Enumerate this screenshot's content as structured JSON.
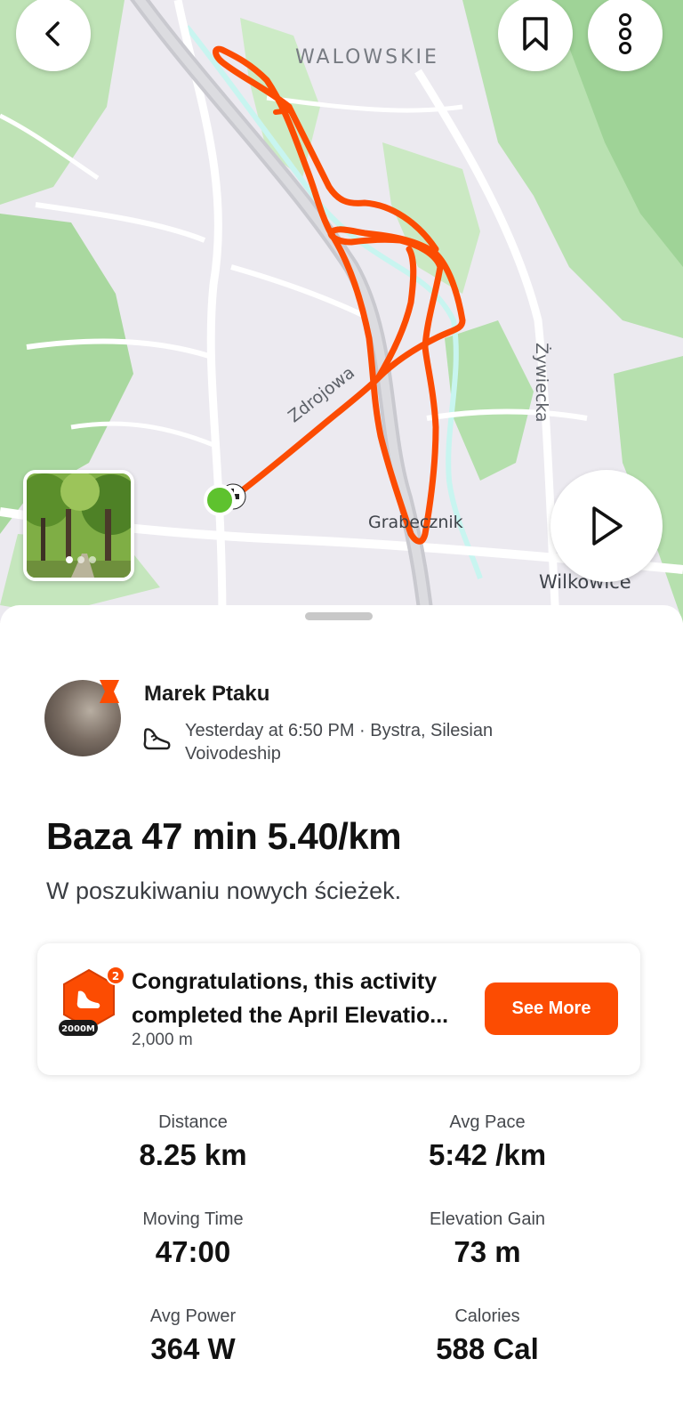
{
  "map": {
    "labels": {
      "walowskie": "WALOWSKIE",
      "zdrojowa": "Zdrojowa",
      "zywiecka": "Żywiecka",
      "grabecznik": "Grabecznik",
      "wilkowice": "Wilkowice"
    },
    "route_color": "#fc4c02",
    "start_color": "#5ec22e",
    "water_color": "#c8f5f0",
    "forest_color": "#b8e0b0",
    "photo_count": 3,
    "photo_active_index": 0
  },
  "top_bar": {
    "back_icon": "chevron-left-icon",
    "bookmark_icon": "bookmark-icon",
    "more_icon": "more-vertical-icon"
  },
  "athlete": {
    "name": "Marek Ptaku",
    "meta": "Yesterday at 6:50 PM · Bystra, Silesian Voivodeship",
    "activity_icon": "run-shoe-icon"
  },
  "activity": {
    "title": "Baza 47 min 5.40/km",
    "description": "W poszukiwaniu nowych ścieżek."
  },
  "challenge": {
    "badge_text": "2000M",
    "title": "Congratulations, this activity completed the April Elevatio...",
    "subtitle": "2,000 m",
    "button_label": "See More",
    "accent": "#fc4c02"
  },
  "stats": [
    {
      "label": "Distance",
      "value": "8.25 km"
    },
    {
      "label": "Avg Pace",
      "value": "5:42 /km"
    },
    {
      "label": "Moving Time",
      "value": "47:00"
    },
    {
      "label": "Elevation Gain",
      "value": "73 m"
    },
    {
      "label": "Avg Power",
      "value": "364 W"
    },
    {
      "label": "Calories",
      "value": "588 Cal"
    }
  ]
}
